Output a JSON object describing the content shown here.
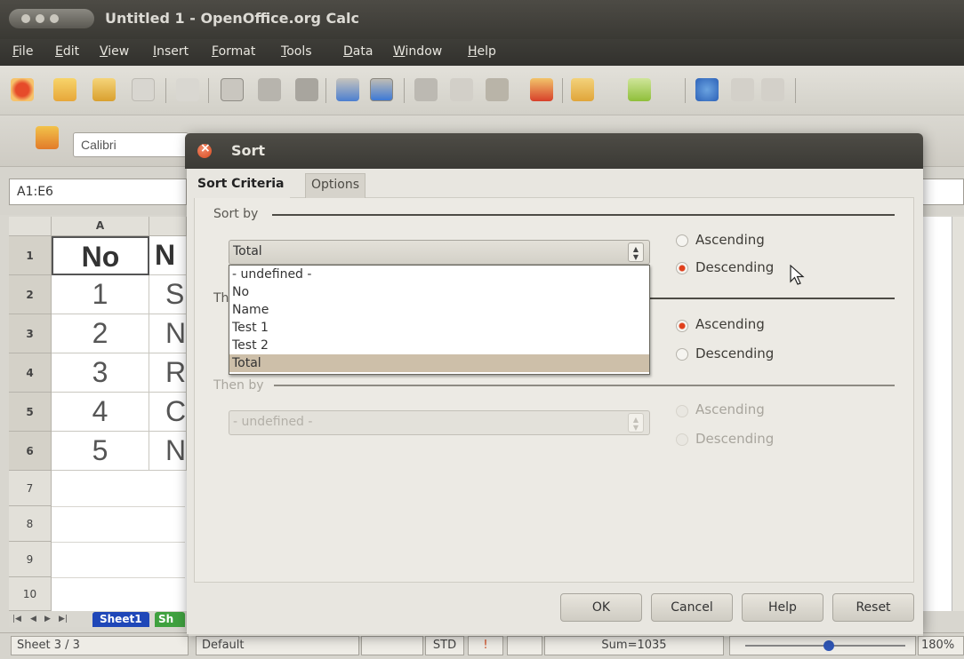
{
  "window": {
    "title": "Untitled 1 - OpenOffice.org Calc"
  },
  "menu": [
    "File",
    "Edit",
    "View",
    "Insert",
    "Format",
    "Tools",
    "Data",
    "Window",
    "Help"
  ],
  "toolbar": {
    "font_name": "Calibri"
  },
  "name_box": "A1:E6",
  "spreadsheet": {
    "column_header": "A",
    "row_numbers": [
      "1",
      "2",
      "3",
      "4",
      "5",
      "6",
      "7",
      "8",
      "9",
      "10"
    ],
    "col_a": [
      "No",
      "1",
      "2",
      "3",
      "4",
      "5"
    ],
    "col_b": [
      "N",
      "S",
      "N",
      "R",
      "C",
      "N"
    ]
  },
  "sheet_tabs": {
    "active": "Sheet1",
    "next": "Sh"
  },
  "status": {
    "sheet": "Sheet 3 / 3",
    "page_style": "Default",
    "mode": "STD",
    "sum": "Sum=1035",
    "zoom": "180%",
    "zoom_level": 0.5
  },
  "dialog": {
    "title": "Sort",
    "tabs": [
      "Sort Criteria",
      "Options"
    ],
    "sort_by_label": "Sort by",
    "then_by_label_1": "Th",
    "then_by_label_2": "Then by",
    "sort_by_value": "Total",
    "then_by_2_value": "- undefined -",
    "dropdown_options": [
      "- undefined -",
      "No",
      "Name",
      "Test 1",
      "Test 2",
      "Total"
    ],
    "dropdown_selected": "Total",
    "key1": {
      "ascending": "Ascending",
      "descending": "Descending",
      "selected": "descending"
    },
    "key2": {
      "ascending": "Ascending",
      "descending": "Descending",
      "selected": "ascending"
    },
    "key3": {
      "ascending": "Ascending",
      "descending": "Descending",
      "selected": "none"
    },
    "buttons": {
      "ok": "OK",
      "cancel": "Cancel",
      "help": "Help",
      "reset": "Reset"
    }
  }
}
